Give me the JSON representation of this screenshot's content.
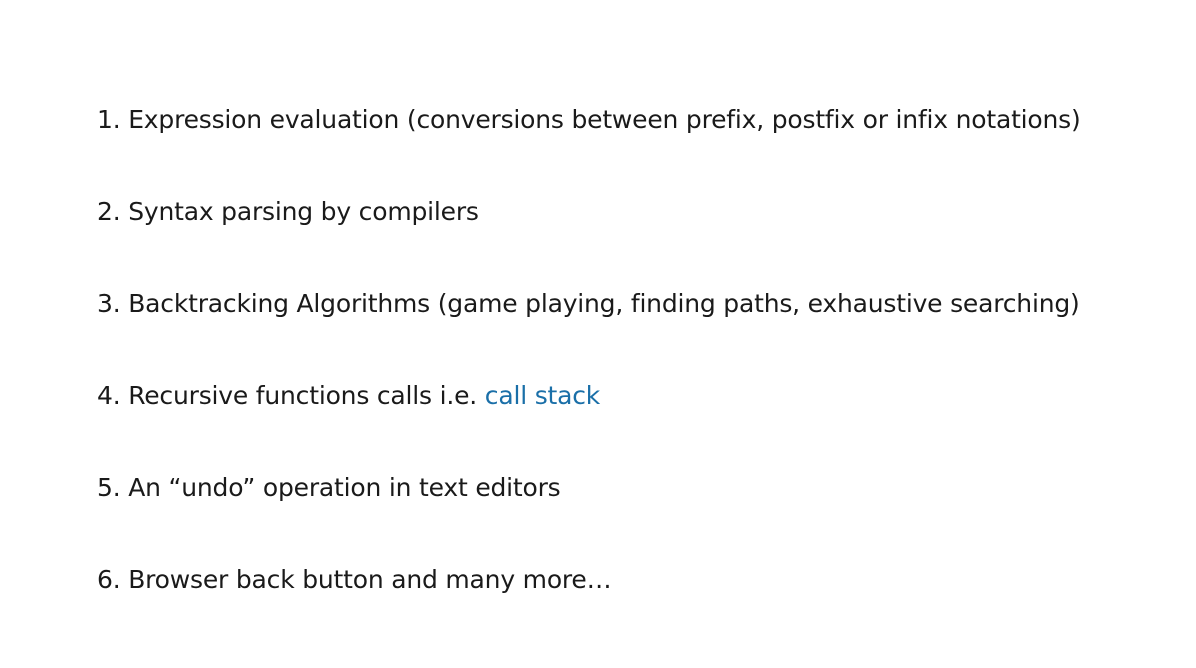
{
  "items": [
    {
      "number": "1.",
      "text": "Expression evaluation (conversions between prefix, postfix or infix notations)"
    },
    {
      "number": "2.",
      "text": "Syntax parsing by compilers"
    },
    {
      "number": "3.",
      "text": "Backtracking Algorithms (game playing, finding paths, exhaustive searching)"
    },
    {
      "number": "4.",
      "text": "Recursive functions calls i.e. ",
      "link": "call stack"
    },
    {
      "number": "5.",
      "text": "An “undo” operation in text editors"
    },
    {
      "number": "6.",
      "text": "Browser back button and many more…"
    }
  ]
}
